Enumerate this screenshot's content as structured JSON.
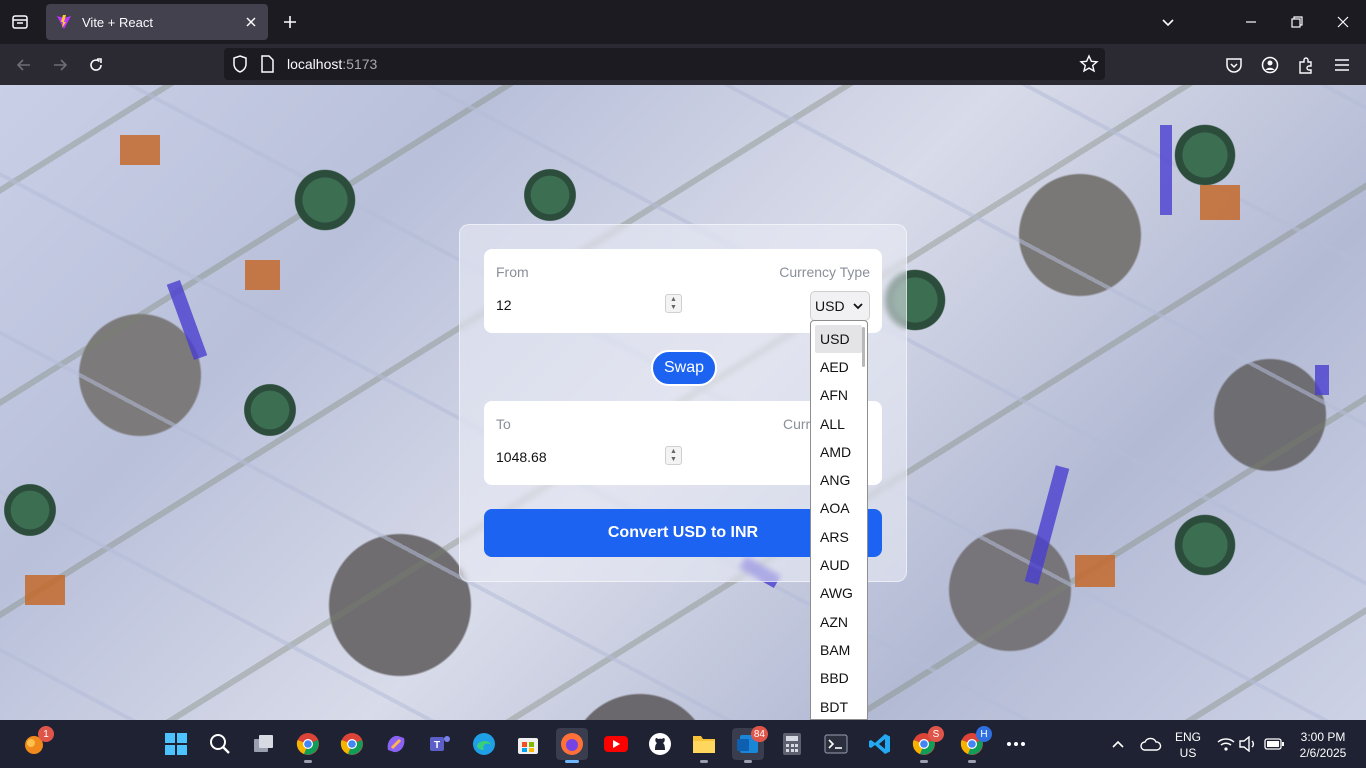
{
  "browser": {
    "tab_title": "Vite + React",
    "url_host": "localhost",
    "url_port": ":5173"
  },
  "converter": {
    "from_label": "From",
    "to_label": "To",
    "currency_type_label": "Currency Type",
    "currency_type_label_partial": "Curr",
    "from_amount": "12",
    "to_amount": "1048.68",
    "from_currency": "USD",
    "swap_label": "Swap",
    "convert_label": "Convert USD to INR"
  },
  "currency_options": [
    "USD",
    "AED",
    "AFN",
    "ALL",
    "AMD",
    "ANG",
    "AOA",
    "ARS",
    "AUD",
    "AWG",
    "AZN",
    "BAM",
    "BBD",
    "BDT"
  ],
  "taskbar": {
    "notification_count": "1",
    "mail_badge": "84",
    "chrome_badge_1": "S",
    "chrome_badge_2": "H",
    "lang_line1": "ENG",
    "lang_line2": "US",
    "time": "3:00 PM",
    "date": "2/6/2025"
  },
  "colors": {
    "accent": "#1d63f2",
    "browser_bg": "#1c1b22",
    "taskbar_bg": "#1f2232"
  }
}
